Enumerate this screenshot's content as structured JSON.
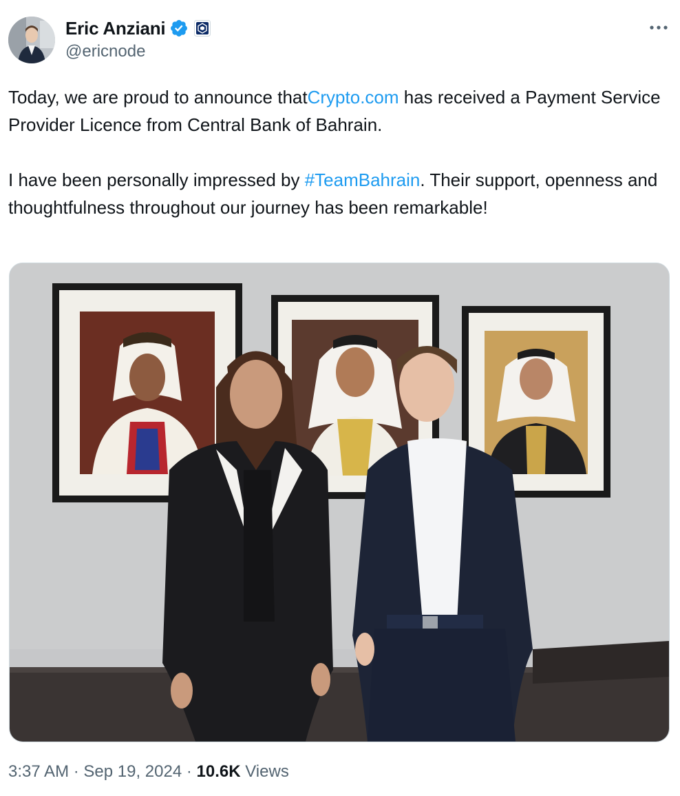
{
  "author": {
    "display_name": "Eric Anziani",
    "handle": "@ericnode",
    "avatar_icon": "profile-photo",
    "verified_icon": "verified-badge-icon",
    "affiliate_icon": "crypto-com-affiliate-icon"
  },
  "tweet": {
    "line1_before": "Today, we are proud to announce that",
    "line1_link": "Crypto.com",
    "line1_after": " has received a Payment Service Provider Licence from Central Bank of Bahrain.",
    "line2_before": "I have been personally impressed by ",
    "line2_hashtag": "#TeamBahrain",
    "line2_after": ". Their support, openness and thoughtfulness throughout our journey has been remarkable!"
  },
  "media": {
    "type": "photo"
  },
  "footer": {
    "time": "3:37 AM",
    "separator": " · ",
    "date": "Sep 19, 2024",
    "views_count": "10.6K",
    "views_label": " Views"
  },
  "colors": {
    "link": "#1d9bf0",
    "text": "#0f1419",
    "secondary": "#536471",
    "verified": "#1d9bf0"
  }
}
